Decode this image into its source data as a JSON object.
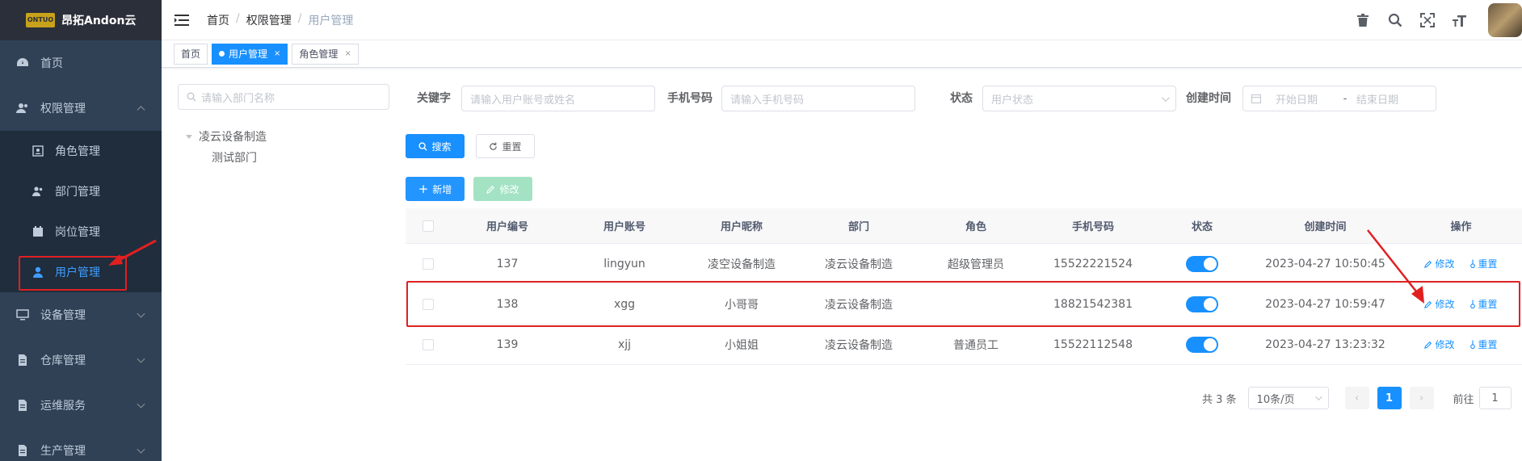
{
  "sidebar": {
    "logo_mark": "ONTUO",
    "logo_title": "昂拓Andon云",
    "items": [
      {
        "label": "首页",
        "icon": "dashboard-icon"
      },
      {
        "label": "权限管理",
        "icon": "user-group-icon",
        "expanded": true
      },
      {
        "label": "设备管理",
        "icon": "monitor-icon"
      },
      {
        "label": "仓库管理",
        "icon": "document-icon"
      },
      {
        "label": "运维服务",
        "icon": "document-icon"
      },
      {
        "label": "生产管理",
        "icon": "document-icon"
      }
    ],
    "sub_items": [
      {
        "label": "角色管理",
        "icon": "role-icon"
      },
      {
        "label": "部门管理",
        "icon": "department-icon"
      },
      {
        "label": "岗位管理",
        "icon": "post-icon"
      },
      {
        "label": "用户管理",
        "icon": "user-icon",
        "active": true
      }
    ]
  },
  "navbar": {
    "breadcrumb": [
      "首页",
      "权限管理",
      "用户管理"
    ],
    "separator": "/"
  },
  "tags": [
    {
      "label": "首页"
    },
    {
      "label": "用户管理",
      "active": true,
      "close": "×"
    },
    {
      "label": "角色管理",
      "close": "×"
    }
  ],
  "tree": {
    "search_placeholder": "请输入部门名称",
    "root": "凌云设备制造",
    "children": [
      "测试部门"
    ]
  },
  "search": {
    "keyword_label": "关键字",
    "keyword_placeholder": "请输入用户账号或姓名",
    "phone_label": "手机号码",
    "phone_placeholder": "请输入手机号码",
    "status_label": "状态",
    "status_placeholder": "用户状态",
    "created_label": "创建时间",
    "start_placeholder": "开始日期",
    "range_sep": "-",
    "end_placeholder": "结束日期",
    "search_btn": "搜索",
    "reset_btn": "重置",
    "add_btn": "新增",
    "edit_btn": "修改"
  },
  "table": {
    "columns": [
      "用户编号",
      "用户账号",
      "用户昵称",
      "部门",
      "角色",
      "手机号码",
      "状态",
      "创建时间",
      "操作"
    ],
    "rows": [
      {
        "id": "137",
        "account": "lingyun",
        "nickname": "凌空设备制造",
        "dept": "凌云设备制造",
        "role": "超级管理员",
        "phone": "15522221524",
        "status": true,
        "created": "2023-04-27 10:50:45",
        "edit": "修改",
        "reset": "重置"
      },
      {
        "id": "138",
        "account": "xgg",
        "nickname": "小哥哥",
        "dept": "凌云设备制造",
        "role": "",
        "phone": "18821542381",
        "status": true,
        "created": "2023-04-27 10:59:47",
        "edit": "修改",
        "reset": "重置"
      },
      {
        "id": "139",
        "account": "xjj",
        "nickname": "小姐姐",
        "dept": "凌云设备制造",
        "role": "普通员工",
        "phone": "15522112548",
        "status": true,
        "created": "2023-04-27 13:23:32",
        "edit": "修改",
        "reset": "重置"
      }
    ]
  },
  "pagination": {
    "total": "共 3 条",
    "page_size": "10条/页",
    "current": "1",
    "goto_label": "前往",
    "goto_value": "1"
  },
  "colors": {
    "primary": "#1890ff",
    "sidebar_bg": "#304156",
    "highlight": "#e02020"
  }
}
